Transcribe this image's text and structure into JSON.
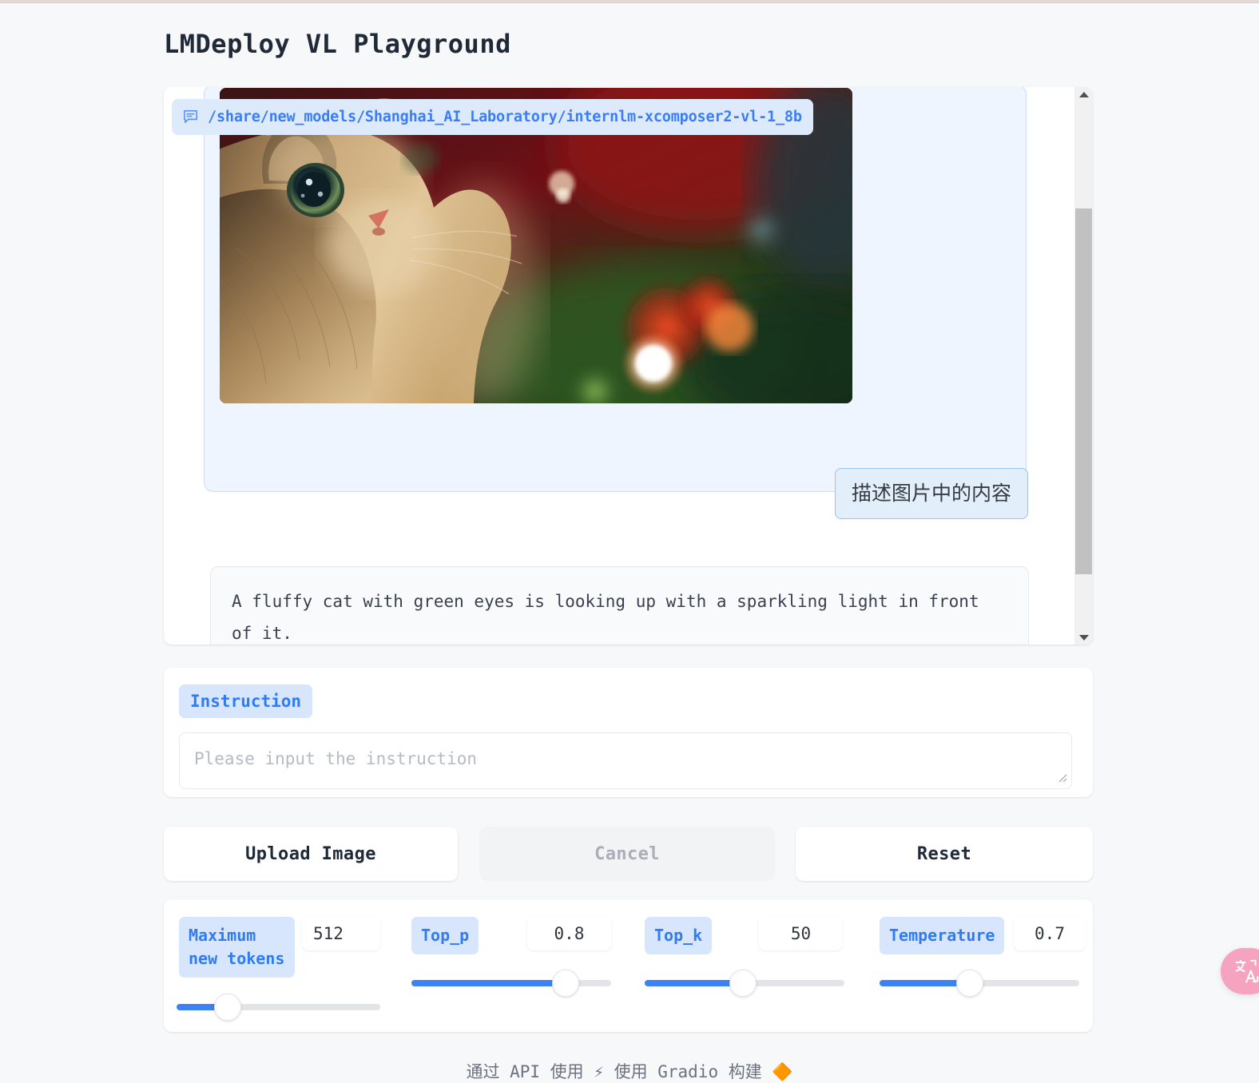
{
  "app": {
    "title": "LMDeploy VL Playground"
  },
  "chat": {
    "model_path": "/share/new_models/Shanghai_AI_Laboratory/internlm-xcomposer2-vl-1_8b",
    "model_path_icon": "chat-bubble-icon",
    "image_alt": "fluffy tabby cat looking up with bokeh christmas lights",
    "user_message": "描述图片中的内容",
    "bot_message": "A fluffy cat with green eyes is looking up with a sparkling light in front of it.",
    "scrollbar": {
      "up_arrow": "▲",
      "down_arrow": "▼"
    }
  },
  "instruction": {
    "label": "Instruction",
    "placeholder": "Please input the instruction",
    "value": "",
    "resize_grip": "◢"
  },
  "actions": {
    "upload_label": "Upload Image",
    "cancel_label": "Cancel",
    "reset_label": "Reset"
  },
  "params": [
    {
      "name": "max-new-tokens",
      "label": "Maximum new tokens",
      "value": "512",
      "fill_percent": 25
    },
    {
      "name": "top-p",
      "label": "Top_p",
      "value": "0.8",
      "fill_percent": 77
    },
    {
      "name": "top-k",
      "label": "Top_k",
      "value": "50",
      "fill_percent": 49
    },
    {
      "name": "temperature",
      "label": "Temperature",
      "value": "0.7",
      "fill_percent": 45
    }
  ],
  "translate_fab": {
    "icon": "translate-icon",
    "glyph_cjk": "中",
    "glyph_latin": "A"
  },
  "footer": {
    "text": "通过 API 使用 ⚡ 使用 Gradio 构建 🔶"
  },
  "colors": {
    "accent_blue": "#3b82f6",
    "chip_blue_bg": "#d8e6fd",
    "chip_blue_text": "#2f7bf2",
    "user_bubble_bg": "#e3eefb",
    "user_bubble_border": "#9cc2ea",
    "image_bubble_bg": "#eef5fe",
    "bot_bubble_bg": "#f9fafb",
    "page_bg": "#f7f8fa",
    "fab_pink": "#f5a3bf",
    "top_strip": "#e3d9d1"
  }
}
